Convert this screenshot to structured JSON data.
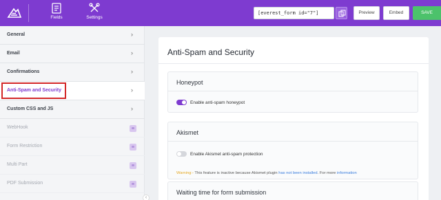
{
  "topbar": {
    "nav": [
      {
        "label": "Fields",
        "icon": "fields-icon"
      },
      {
        "label": "Settings",
        "icon": "settings-icon"
      }
    ],
    "shortcode": "[everest_form id=\"7\"]",
    "preview_label": "Preview",
    "embed_label": "Embed",
    "save_label": "SAVE"
  },
  "sidebar": {
    "items": [
      {
        "label": "General",
        "state": "normal"
      },
      {
        "label": "Email",
        "state": "normal"
      },
      {
        "label": "Confirmations",
        "state": "normal"
      },
      {
        "label": "Anti-Spam and Security",
        "state": "active"
      },
      {
        "label": "Custom CSS and JS",
        "state": "normal"
      },
      {
        "label": "WebHook",
        "state": "locked"
      },
      {
        "label": "Form Restriction",
        "state": "locked"
      },
      {
        "label": "Multi Part",
        "state": "locked"
      },
      {
        "label": "PDF Submission",
        "state": "locked"
      }
    ]
  },
  "main": {
    "title": "Anti-Spam and Security",
    "honeypot": {
      "heading": "Honeypot",
      "toggle_label": "Enable anti-spam honeypot",
      "enabled": true
    },
    "akismet": {
      "heading": "Akismet",
      "toggle_label": "Enable Akismet anti-spam protection",
      "enabled": false,
      "warning_prefix": "Warning:-",
      "warning_text": " This feature is inactive because Akismet plugin ",
      "warning_link": "has not been installed",
      "warning_suffix": ". For more ",
      "info_link": "information"
    },
    "waiting": {
      "heading": "Waiting time for form submission"
    }
  },
  "colors": {
    "brand": "#7e3bd0",
    "save": "#4cc26b",
    "highlight": "#d32626",
    "warning": "#e5a823",
    "link": "#3b7ddd"
  }
}
